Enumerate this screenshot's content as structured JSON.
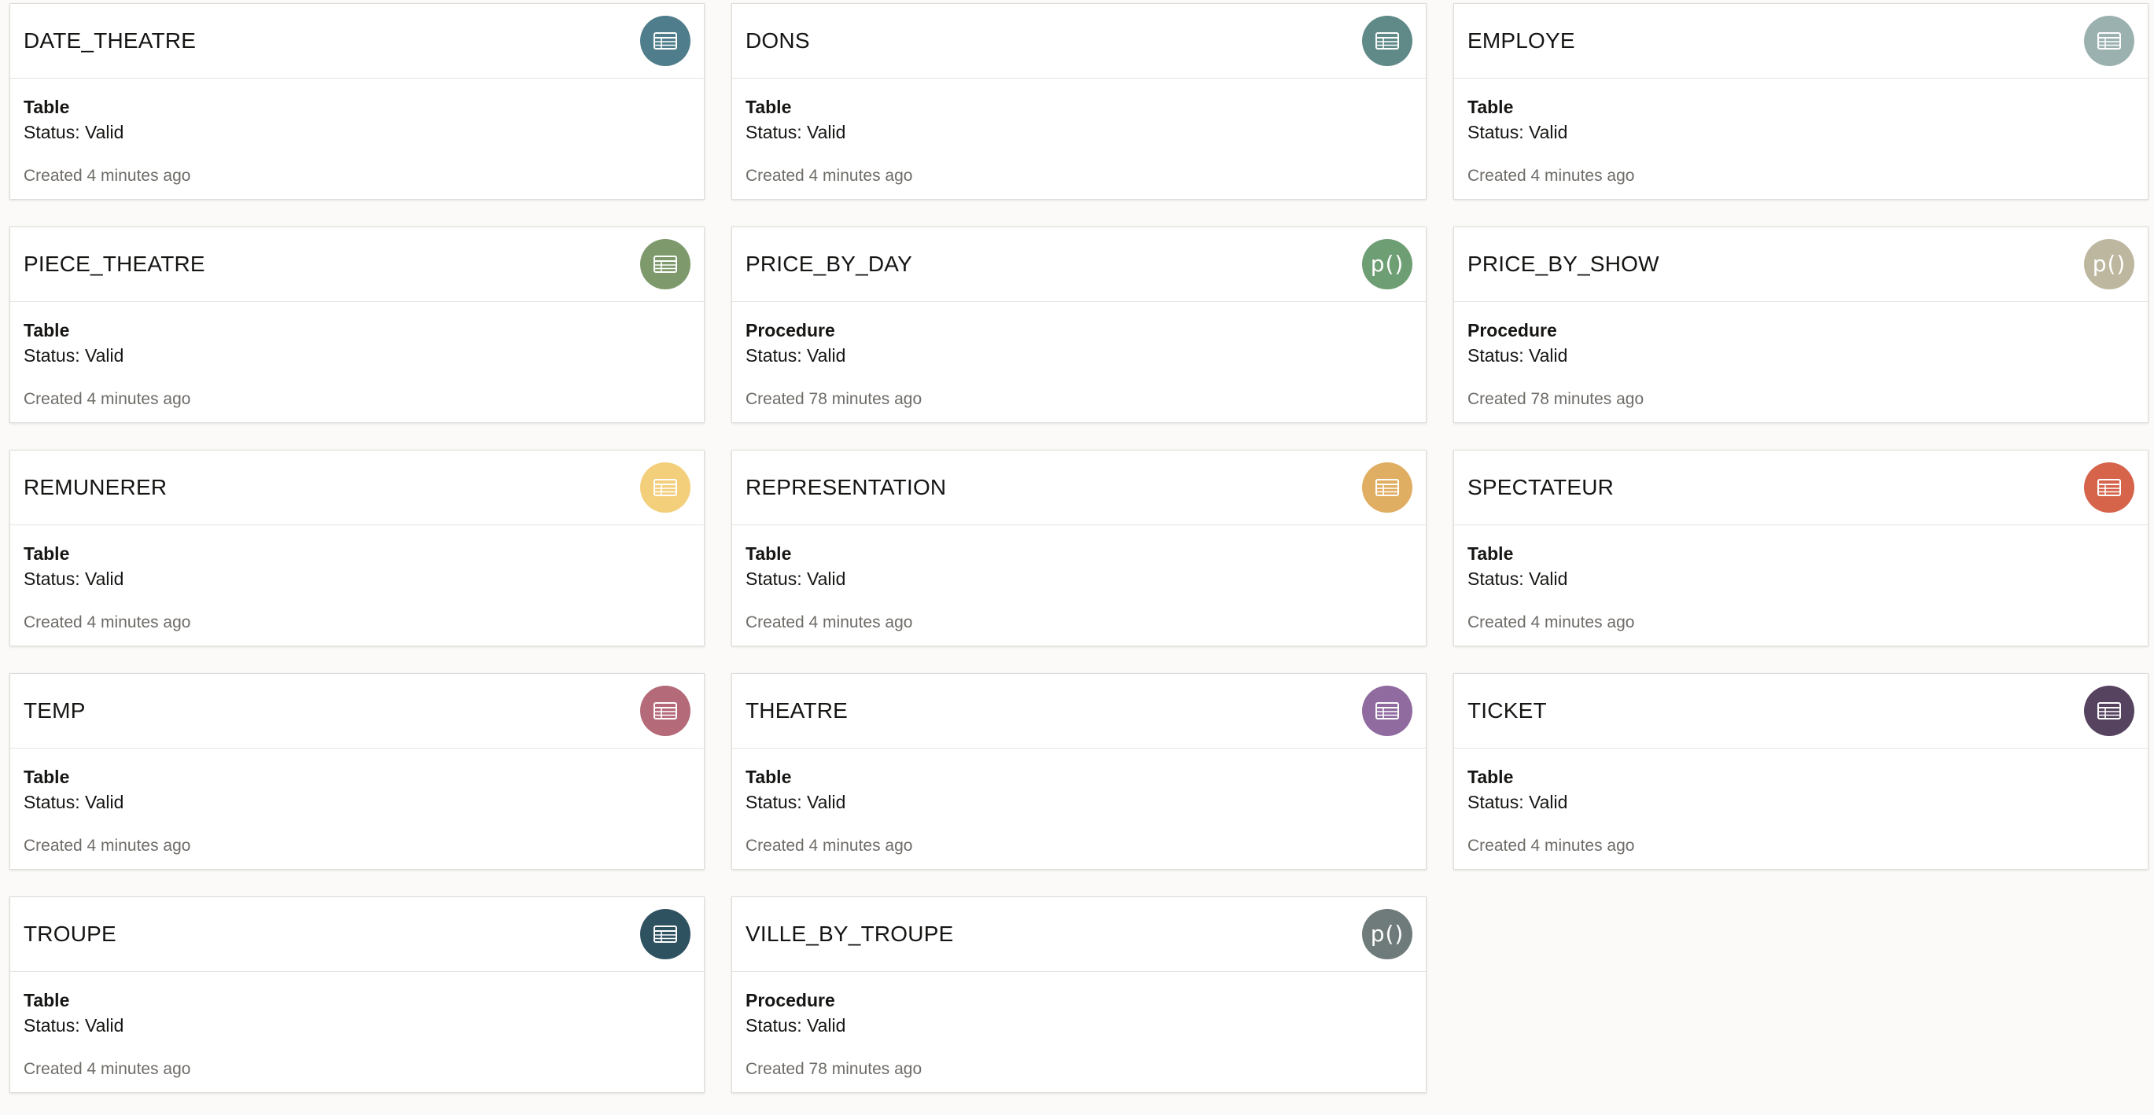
{
  "objects": [
    {
      "name": "DATE_THEATRE",
      "type": "Table",
      "status": "Status: Valid",
      "created": "Created 4 minutes ago",
      "icon": "table-icon",
      "color": "#4f7d8b"
    },
    {
      "name": "DONS",
      "type": "Table",
      "status": "Status: Valid",
      "created": "Created 4 minutes ago",
      "icon": "table-icon",
      "color": "#5f8a88"
    },
    {
      "name": "EMPLOYE",
      "type": "Table",
      "status": "Status: Valid",
      "created": "Created 4 minutes ago",
      "icon": "table-icon",
      "color": "#9bb1b0"
    },
    {
      "name": "PIECE_THEATRE",
      "type": "Table",
      "status": "Status: Valid",
      "created": "Created 4 minutes ago",
      "icon": "table-icon",
      "color": "#7e9a6c"
    },
    {
      "name": "PRICE_BY_DAY",
      "type": "Procedure",
      "status": "Status: Valid",
      "created": "Created 78 minutes ago",
      "icon": "procedure-icon",
      "color": "#6e9e74",
      "icon_text": "p()"
    },
    {
      "name": "PRICE_BY_SHOW",
      "type": "Procedure",
      "status": "Status: Valid",
      "created": "Created 78 minutes ago",
      "icon": "procedure-icon",
      "color": "#bdb79f",
      "icon_text": "p()"
    },
    {
      "name": "REMUNERER",
      "type": "Table",
      "status": "Status: Valid",
      "created": "Created 4 minutes ago",
      "icon": "table-icon",
      "color": "#f3cf7c"
    },
    {
      "name": "REPRESENTATION",
      "type": "Table",
      "status": "Status: Valid",
      "created": "Created 4 minutes ago",
      "icon": "table-icon",
      "color": "#e0ae62"
    },
    {
      "name": "SPECTATEUR",
      "type": "Table",
      "status": "Status: Valid",
      "created": "Created 4 minutes ago",
      "icon": "table-icon",
      "color": "#d5644b"
    },
    {
      "name": "TEMP",
      "type": "Table",
      "status": "Status: Valid",
      "created": "Created 4 minutes ago",
      "icon": "table-icon",
      "color": "#b46a79"
    },
    {
      "name": "THEATRE",
      "type": "Table",
      "status": "Status: Valid",
      "created": "Created 4 minutes ago",
      "icon": "table-icon",
      "color": "#8f6ba0"
    },
    {
      "name": "TICKET",
      "type": "Table",
      "status": "Status: Valid",
      "created": "Created 4 minutes ago",
      "icon": "table-icon",
      "color": "#56435f"
    },
    {
      "name": "TROUPE",
      "type": "Table",
      "status": "Status: Valid",
      "created": "Created 4 minutes ago",
      "icon": "table-icon",
      "color": "#2f5261"
    },
    {
      "name": "VILLE_BY_TROUPE",
      "type": "Procedure",
      "status": "Status: Valid",
      "created": "Created 78 minutes ago",
      "icon": "procedure-icon",
      "color": "#6e7b7a",
      "icon_text": "p()"
    }
  ]
}
